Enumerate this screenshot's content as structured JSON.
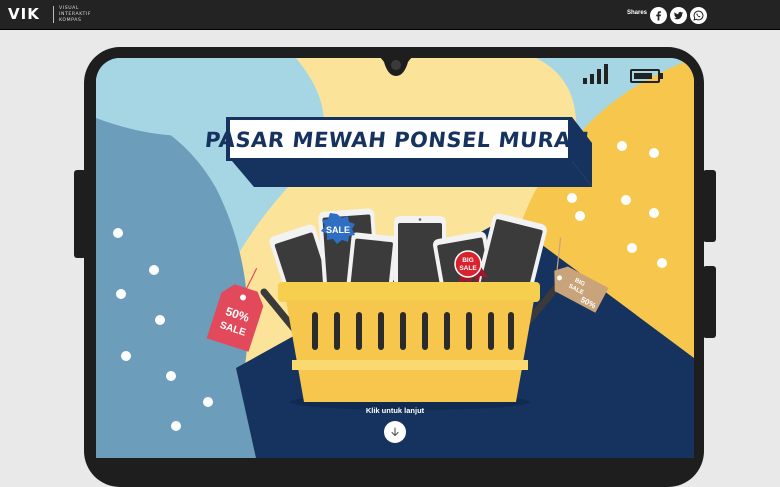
{
  "header": {
    "logo": "VIK",
    "logo_sub": [
      "VISUAL",
      "INTERAKTIF",
      "KOMPAS"
    ],
    "shares_label": "Shares",
    "share_icons": [
      "facebook-icon",
      "twitter-icon",
      "whatsapp-icon"
    ]
  },
  "hero": {
    "title": "PASAR MEWAH PONSEL MURAH",
    "tags": {
      "left": [
        "50%",
        "SALE"
      ],
      "phone": "SALE",
      "badge": [
        "BIG",
        "SALE"
      ],
      "right": [
        "BIG",
        "SALE",
        "50%"
      ]
    }
  },
  "cta": {
    "label": "Klik untuk lanjut",
    "icon": "arrow-down-icon"
  },
  "colors": {
    "topbar": "#232323",
    "sky": "#a6d6e4",
    "yellow": "#f6c64d",
    "cream": "#fbe49a",
    "navy": "#16325e",
    "steel": "#6c9dbb",
    "tag_red": "#e24a5b",
    "badge_red": "#d8232f",
    "tag_tan": "#c9a47a",
    "phone_frame": "#1e1e1e"
  }
}
